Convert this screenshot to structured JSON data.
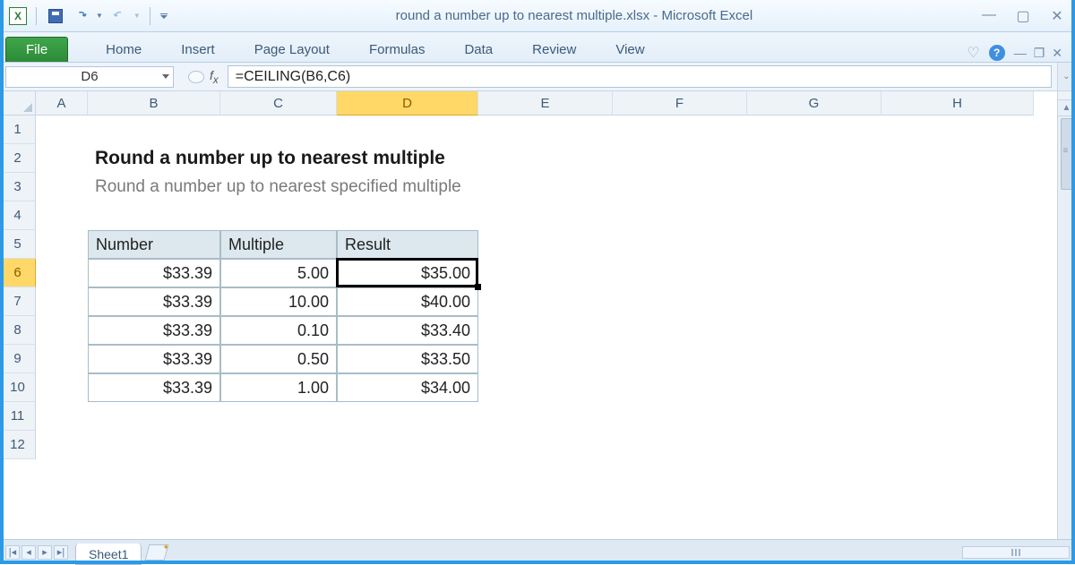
{
  "title": "round a number up to nearest multiple.xlsx  -  Microsoft Excel",
  "ribbon": {
    "file": "File",
    "tabs": [
      "Home",
      "Insert",
      "Page Layout",
      "Formulas",
      "Data",
      "Review",
      "View"
    ]
  },
  "namebox": "D6",
  "formula": "=CEILING(B6,C6)",
  "columns": [
    "A",
    "B",
    "C",
    "D",
    "E",
    "F",
    "G",
    "H"
  ],
  "selected_col_index": 3,
  "rows": [
    1,
    2,
    3,
    4,
    5,
    6,
    7,
    8,
    9,
    10,
    11,
    12
  ],
  "selected_row_index": 5,
  "content": {
    "title": "Round a number up to nearest multiple",
    "subtitle": "Round a number up to nearest specified multiple",
    "headers": {
      "b": "Number",
      "c": "Multiple",
      "d": "Result"
    },
    "data": [
      {
        "b": "$33.39",
        "c": "5.00",
        "d": "$35.00"
      },
      {
        "b": "$33.39",
        "c": "10.00",
        "d": "$40.00"
      },
      {
        "b": "$33.39",
        "c": "0.10",
        "d": "$33.40"
      },
      {
        "b": "$33.39",
        "c": "0.50",
        "d": "$33.50"
      },
      {
        "b": "$33.39",
        "c": "1.00",
        "d": "$34.00"
      }
    ]
  },
  "sheet": "Sheet1",
  "chart_data": {
    "type": "table",
    "title": "Round a number up to nearest multiple",
    "columns": [
      "Number",
      "Multiple",
      "Result"
    ],
    "rows": [
      [
        33.39,
        5.0,
        35.0
      ],
      [
        33.39,
        10.0,
        40.0
      ],
      [
        33.39,
        0.1,
        33.4
      ],
      [
        33.39,
        0.5,
        33.5
      ],
      [
        33.39,
        1.0,
        34.0
      ]
    ]
  }
}
